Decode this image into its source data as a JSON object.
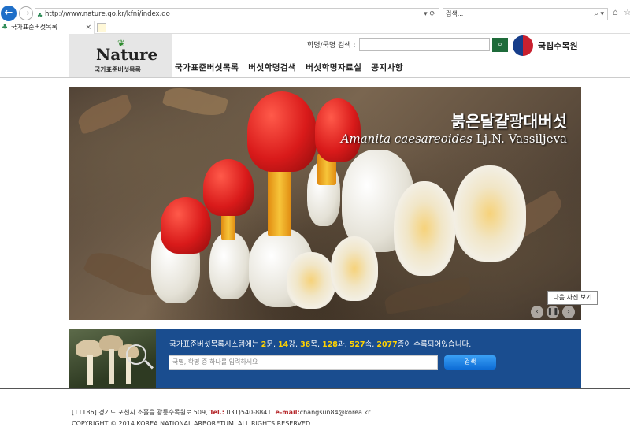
{
  "browser": {
    "url": "http://www.nature.go.kr/kfni/index.do",
    "search_placeholder": "검색...",
    "tab_title": "국가표준버섯목록"
  },
  "header": {
    "logo_word": "Nature",
    "logo_sub": "국가표준버섯목록",
    "search_label": "학명/국명 검색 :",
    "org_name": "국립수목원",
    "nav": [
      "국가표준버섯목록",
      "버섯학명검색",
      "버섯학명자료실",
      "공지사항"
    ]
  },
  "hero": {
    "korean_name": "붉은달걀광대버섯",
    "scientific_name": "Amanita caesareoides",
    "author": "Lj.N. Vassiljeva",
    "tooltip": "다음 사진 보기"
  },
  "band": {
    "sentence_prefix": "국가표준버섯목록시스템에는 ",
    "counts": [
      {
        "value": "2",
        "unit": "문, "
      },
      {
        "value": "14",
        "unit": "강, "
      },
      {
        "value": "36",
        "unit": "목, "
      },
      {
        "value": "128",
        "unit": "과, "
      },
      {
        "value": "527",
        "unit": "속, "
      },
      {
        "value": "2077",
        "unit": "종이 수록되어있습니다."
      }
    ],
    "input_placeholder": "국명, 학명 중 하나를 입력하세요",
    "search_button": "검색"
  },
  "footer": {
    "address": "[11186] 경기도 포천시 소흘읍 광릉수목원로 509, ",
    "tel_label": "Tel.:",
    "tel": " 031)540-8841, ",
    "email_label": "e-mail:",
    "email": "changsun84@korea.kr",
    "copyright": "COPYRIGHT © 2014 KOREA NATIONAL ARBORETUM. ALL RIGHTS RESERVED."
  },
  "colors": {
    "band_blue": "#1a4d8f",
    "highlight_yellow": "#ffd200",
    "header_green": "#1e6b3a"
  }
}
